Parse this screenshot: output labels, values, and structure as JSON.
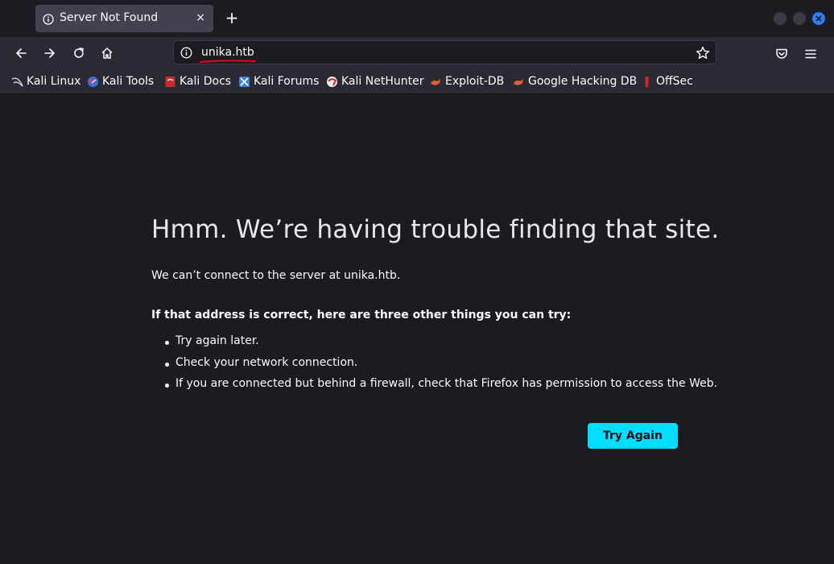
{
  "browser": {
    "tab": {
      "title": "Server Not Found",
      "close_glyph": "×"
    },
    "new_tab_glyph": "+",
    "url": "unika.htb",
    "accent_underline_color": "#e0001a"
  },
  "bookmarks": [
    {
      "label": "Kali Linux",
      "icon": "kali-dragon-icon"
    },
    {
      "label": "Kali Tools",
      "icon": "kali-tools-icon"
    },
    {
      "label": "Kali Docs",
      "icon": "kali-docs-icon"
    },
    {
      "label": "Kali Forums",
      "icon": "kali-forums-icon"
    },
    {
      "label": "Kali NetHunter",
      "icon": "kali-nethunter-icon"
    },
    {
      "label": "Exploit-DB",
      "icon": "exploit-db-icon"
    },
    {
      "label": "Google Hacking DB",
      "icon": "ghdb-icon"
    },
    {
      "label": "OffSec",
      "icon": "offsec-icon"
    }
  ],
  "error": {
    "title": "Hmm. We’re having trouble finding that site.",
    "description": "We can’t connect to the server at unika.htb.",
    "tips_heading": "If that address is correct, here are three other things you can try:",
    "tips": [
      "Try again later.",
      "Check your network connection.",
      "If you are connected but behind a firewall, check that Firefox has permission to access the Web."
    ],
    "button_label": "Try Again",
    "button_color": "#00ddff"
  }
}
